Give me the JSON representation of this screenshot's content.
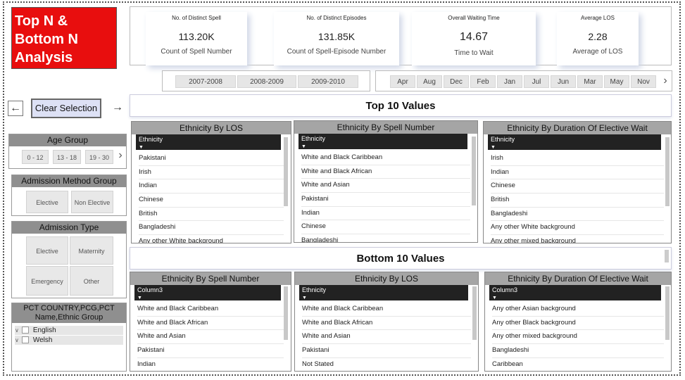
{
  "title": "Top N & Bottom N Analysis",
  "title_lines": [
    "Top N &",
    "Bottom N",
    "Analysis"
  ],
  "kpis": [
    {
      "label": "No. of Distinct Spell",
      "value": "113.20K",
      "sub": "Count of Spell Number"
    },
    {
      "label": "No. of Distinct Episodes",
      "value": "131.85K",
      "sub": "Count of Spell-Episode Number"
    },
    {
      "label": "Overall Waiting Time",
      "value": "14.67",
      "sub": "Time to Wait"
    },
    {
      "label": "Average LOS",
      "value": "2.28",
      "sub": "Average of LOS"
    }
  ],
  "years": [
    "2007-2008",
    "2008-2009",
    "2009-2010"
  ],
  "months": [
    "Apr",
    "Aug",
    "Dec",
    "Feb",
    "Jan",
    "Jul",
    "Jun",
    "Mar",
    "May",
    "Nov"
  ],
  "nav": {
    "back": "←",
    "forward": "→",
    "clear": "Clear Selection",
    "chevron": "›"
  },
  "age_group": {
    "title": "Age Group",
    "items": [
      "0 - 12",
      "13 - 18",
      "19 - 30"
    ]
  },
  "admission_method": {
    "title": "Admission Method Group",
    "items": [
      "Elective",
      "Non Elective"
    ]
  },
  "admission_type": {
    "title": "Admission Type",
    "items": [
      "Elective",
      "Maternity",
      "Emergency",
      "Other"
    ]
  },
  "pct": {
    "title_line1": "PCT COUNTRY,PCG,PCT",
    "title_line2": "Name,Ethnic Group",
    "items": [
      "English",
      "Welsh"
    ]
  },
  "top_section": "Top 10 Values",
  "bottom_section": "Bottom 10 Values",
  "top_tables": [
    {
      "title": "Ethnicity By LOS",
      "header": "Ethnicity",
      "rows": [
        "Pakistani",
        "Irish",
        "Indian",
        "Chinese",
        "British",
        "Bangladeshi",
        "Any other White background"
      ]
    },
    {
      "title": "Ethnicity By Spell Number",
      "header": "Ethnicity",
      "rows": [
        "White and Black Caribbean",
        "White and Black African",
        "White and Asian",
        "Pakistani",
        "Indian",
        "Chinese",
        "Bangladeshi"
      ]
    },
    {
      "title": "Ethnicity By Duration Of Elective Wait",
      "header": "Ethnicity",
      "rows": [
        "Irish",
        "Indian",
        "Chinese",
        "British",
        "Bangladeshi",
        "Any other White background",
        "Any other mixed background"
      ]
    }
  ],
  "bottom_tables": [
    {
      "title": "Ethnicity By Spell Number",
      "header": "Column3",
      "rows": [
        "White and Black Caribbean",
        "White and Black African",
        "White and Asian",
        "Pakistani",
        "Indian"
      ]
    },
    {
      "title": "Ethnicity By LOS",
      "header": "Ethnicity",
      "rows": [
        "White and Black Caribbean",
        "White and Black African",
        "White and Asian",
        "Pakistani",
        "Not Stated"
      ]
    },
    {
      "title": "Ethnicity By Duration Of Elective Wait",
      "header": "Column3",
      "rows": [
        "Any other Asian background",
        "Any other Black background",
        "Any other mixed background",
        "Bangladeshi",
        "Caribbean"
      ]
    }
  ]
}
